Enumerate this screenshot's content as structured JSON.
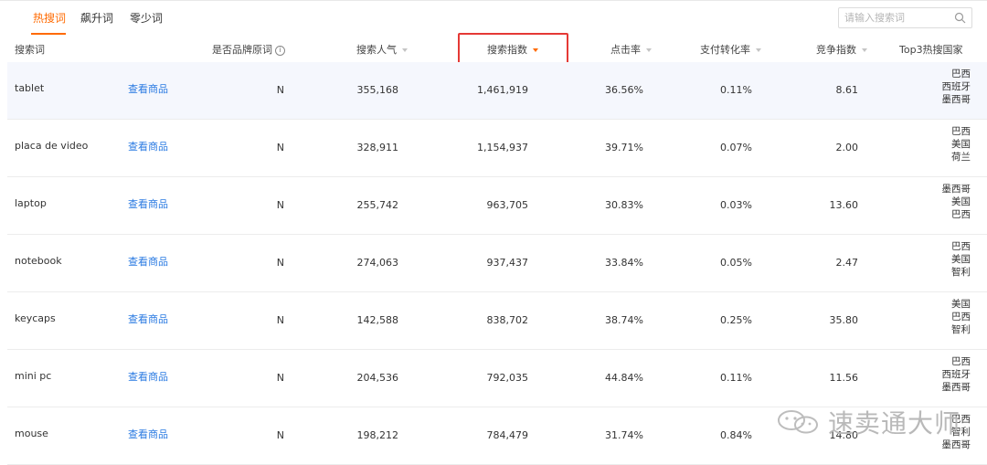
{
  "tabs": [
    {
      "label": "热搜词",
      "active": true
    },
    {
      "label": "飙升词",
      "active": false
    },
    {
      "label": "零少词",
      "active": false
    }
  ],
  "search": {
    "placeholder": "请输入搜索词",
    "icon": "search-icon"
  },
  "columns": {
    "keyword": "搜索词",
    "is_brand": "是否品牌原词",
    "popularity": "搜索人气",
    "index": "搜索指数",
    "ctr": "点击率",
    "conversion": "支付转化率",
    "competition": "竞争指数",
    "top3": "Top3热搜国家"
  },
  "sorted_column": "index",
  "rows": [
    {
      "keyword": "tablet",
      "action": "查看商品",
      "is_brand": "N",
      "popularity": "355,168",
      "index": "1,461,919",
      "ctr": "36.56%",
      "conversion": "0.11%",
      "competition": "8.61",
      "countries": [
        "巴西",
        "西班牙",
        "墨西哥"
      ]
    },
    {
      "keyword": "placa de video",
      "action": "查看商品",
      "is_brand": "N",
      "popularity": "328,911",
      "index": "1,154,937",
      "ctr": "39.71%",
      "conversion": "0.07%",
      "competition": "2.00",
      "countries": [
        "巴西",
        "美国",
        "荷兰"
      ]
    },
    {
      "keyword": "laptop",
      "action": "查看商品",
      "is_brand": "N",
      "popularity": "255,742",
      "index": "963,705",
      "ctr": "30.83%",
      "conversion": "0.03%",
      "competition": "13.60",
      "countries": [
        "墨西哥",
        "美国",
        "巴西"
      ]
    },
    {
      "keyword": "notebook",
      "action": "查看商品",
      "is_brand": "N",
      "popularity": "274,063",
      "index": "937,437",
      "ctr": "33.84%",
      "conversion": "0.05%",
      "competition": "2.47",
      "countries": [
        "巴西",
        "美国",
        "智利"
      ]
    },
    {
      "keyword": "keycaps",
      "action": "查看商品",
      "is_brand": "N",
      "popularity": "142,588",
      "index": "838,702",
      "ctr": "38.74%",
      "conversion": "0.25%",
      "competition": "35.80",
      "countries": [
        "美国",
        "巴西",
        "智利"
      ]
    },
    {
      "keyword": "mini pc",
      "action": "查看商品",
      "is_brand": "N",
      "popularity": "204,536",
      "index": "792,035",
      "ctr": "44.84%",
      "conversion": "0.11%",
      "competition": "11.56",
      "countries": [
        "巴西",
        "西班牙",
        "墨西哥"
      ]
    },
    {
      "keyword": "mouse",
      "action": "查看商品",
      "is_brand": "N",
      "popularity": "198,212",
      "index": "784,479",
      "ctr": "31.74%",
      "conversion": "0.84%",
      "competition": "14.80",
      "countries": [
        "巴西",
        "智利",
        "墨西哥"
      ]
    }
  ],
  "watermark": "速卖通大师",
  "colors": {
    "accent": "#ff6a00",
    "link": "#2a7ae2",
    "highlight": "#e53935"
  }
}
